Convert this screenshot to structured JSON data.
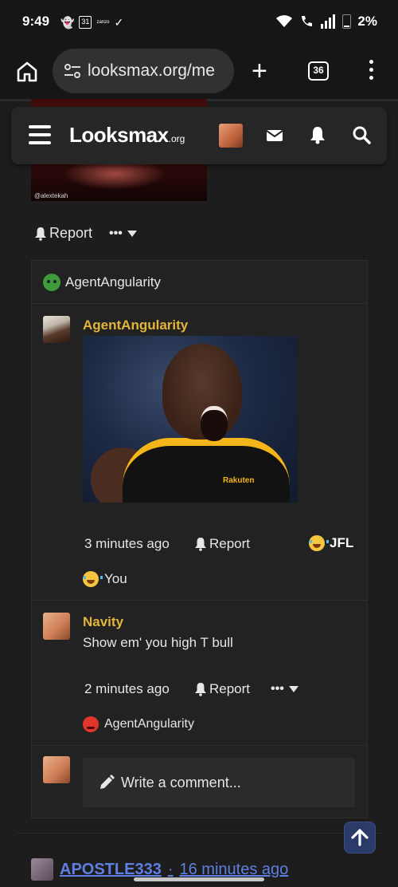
{
  "status_bar": {
    "time": "9:49",
    "calendar_day": "31",
    "tiny_label": "zanzo",
    "battery": "2%"
  },
  "browser": {
    "url": "looksmax.org/me",
    "tab_count": "36",
    "new_tab_glyph": "+"
  },
  "header": {
    "logo_main": "Looksmax",
    "logo_suffix": ".org"
  },
  "previous_post": {
    "watermark": "@alextekah",
    "report_label": "Report",
    "more_label": "•••"
  },
  "comments": {
    "reaction_summary_user": "AgentAngularity",
    "items": [
      {
        "author": "AgentAngularity",
        "image_brand_text": "Rakuten",
        "time": "3 minutes ago",
        "report_label": "Report",
        "reaction_label": "JFL",
        "reacted_by": "You"
      },
      {
        "author": "Navity",
        "text": "Show em' you high T bull",
        "time": "2 minutes ago",
        "report_label": "Report",
        "more_label": "•••",
        "reacted_by": "AgentAngularity"
      }
    ],
    "write_placeholder": "Write a comment..."
  },
  "next_post": {
    "author": "APOSTLE333",
    "separator": "·",
    "time": "16 minutes ago"
  },
  "colors": {
    "accent_author": "#e3b53a",
    "link": "#5f7fe2",
    "background": "#1d1d1d"
  }
}
